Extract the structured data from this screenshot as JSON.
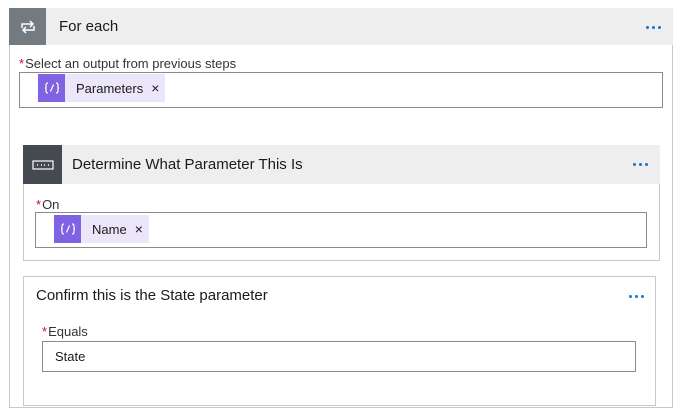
{
  "foreach": {
    "title": "For each",
    "icon": "loop-icon",
    "field_label": "Select an output from previous steps",
    "token": {
      "label": "Parameters",
      "icon": "expression-icon",
      "remove": "×"
    }
  },
  "switch": {
    "title": "Determine What Parameter This Is",
    "icon": "switch-icon",
    "field_label": "On",
    "token": {
      "label": "Name",
      "icon": "expression-icon",
      "remove": "×"
    }
  },
  "case": {
    "title": "Confirm this is the State parameter",
    "field_label": "Equals",
    "value": "State"
  },
  "required_marker": "*",
  "colors": {
    "accent": "#1e74c7",
    "token_icon_bg": "#7f63e2",
    "token_bg": "#ece6fb",
    "required": "#c50f1f",
    "loop_tile": "#737a80",
    "switch_tile": "#454a50",
    "header_bg": "#eeeeee"
  }
}
